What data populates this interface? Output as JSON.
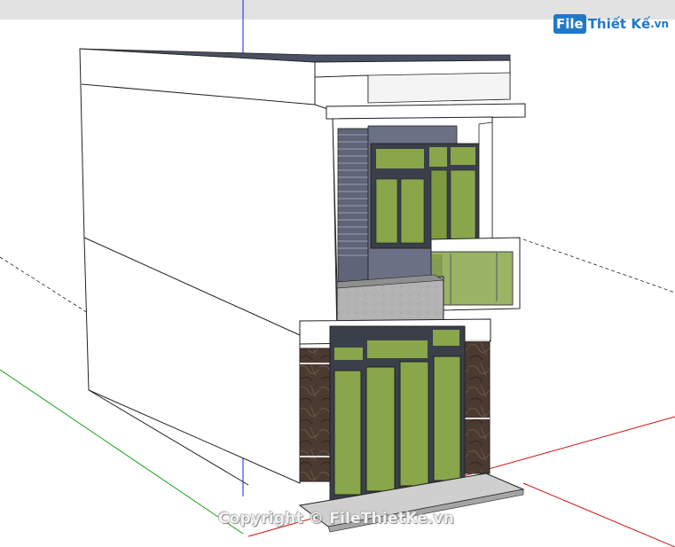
{
  "watermark": {
    "logo_badge": "File",
    "logo_text": "Thiết Kế",
    "logo_suffix": ".vn",
    "copyright": "Copyright © FileThietKe.vn"
  },
  "colors": {
    "canvas": "#ffffff",
    "top_bar": "#e2e2e2",
    "axis_red": "#d01010",
    "axis_green": "#14a014",
    "axis_blue": "#1a1aff",
    "glass": "#8aa64a",
    "frame": "#3a3f4a",
    "marble": "#4a3a30",
    "wall_dark": "#5d6275",
    "logo_blue": "#1f78c8"
  }
}
